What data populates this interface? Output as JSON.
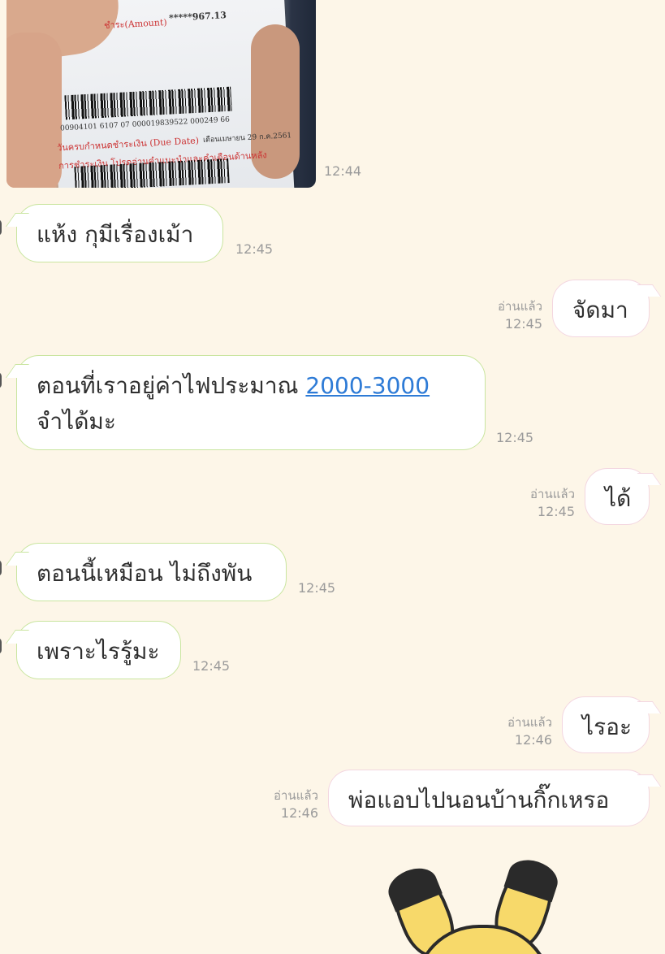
{
  "photo": {
    "amount_label": "ชำระ(Amount)",
    "amount_value": "*****967.13",
    "barcode_number": "00904101 6107 07 000019839522 000249 66",
    "due_date_label": "วันครบกำหนดชำระเงิน (Due Date)",
    "due_date_value": "เดือนเมษายน 29 ก.ค.2561",
    "note": "การชำระเงิน โปรดอ่านคำแนะนำและคำเตือนด้านหลัง",
    "time": "12:44"
  },
  "messages": [
    {
      "side": "in",
      "text": "แห้ง กุมีเรื่องเม้า",
      "time": "12:45"
    },
    {
      "side": "out",
      "text": "จัดมา",
      "read": "อ่านแล้ว",
      "time": "12:45"
    },
    {
      "side": "in",
      "line1_prefix": "ตอนที่เราอยู่ค่าไฟประมาณ ",
      "line1_link": "2000-3000",
      "line2": "จำได้มะ",
      "time": "12:45"
    },
    {
      "side": "out",
      "text": "ได้",
      "read": "อ่านแล้ว",
      "time": "12:45"
    },
    {
      "side": "in",
      "text": "ตอนนี้เหมือน ไม่ถึงพัน",
      "time": "12:45"
    },
    {
      "side": "in",
      "text": "เพราะไรรู้มะ",
      "time": "12:45"
    },
    {
      "side": "out",
      "text": "ไรอะ",
      "read": "อ่านแล้ว",
      "time": "12:46"
    },
    {
      "side": "out",
      "text": "พ่อแอบไปนอนบ้านกิ๊กเหรอ",
      "read": "อ่านแล้ว",
      "time": "12:46"
    }
  ],
  "colors": {
    "background": "#fdf6e8",
    "incoming_border": "#c9e59f",
    "outgoing_border": "#f3d6e0",
    "link": "#2e7bd6"
  },
  "sticker": {
    "icon": "yellow-cat-sticker"
  }
}
